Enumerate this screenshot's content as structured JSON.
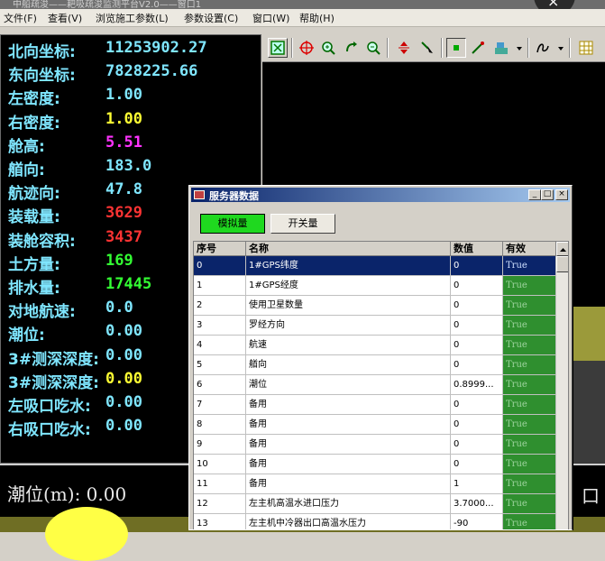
{
  "window": {
    "title": "中船疏浚——耙吸疏浚监测平台V2.0——窗口1"
  },
  "close_overlay": {
    "glyph": "×"
  },
  "menu": [
    {
      "label": "文件(F)"
    },
    {
      "label": "查看(V)"
    },
    {
      "label": "浏览施工参数(L)"
    },
    {
      "label": "参数设置(C)"
    },
    {
      "label": "窗口(W)"
    },
    {
      "label": "帮助(H)"
    }
  ],
  "left_panel": {
    "rows": [
      {
        "label": "北向坐标:",
        "value": "11253902.27",
        "color": "#7fe6ff"
      },
      {
        "label": "东向坐标:",
        "value": "7828225.66",
        "color": "#7fe6ff"
      },
      {
        "label": "左密度:",
        "value": "1.00",
        "color": "#7fe6ff"
      },
      {
        "label": "右密度:",
        "value": "1.00",
        "color": "#ffff33"
      },
      {
        "label": "舱高:",
        "value": "5.51",
        "color": "#ff33ff"
      },
      {
        "label": "艏向:",
        "value": "183.0",
        "color": "#7fe6ff"
      },
      {
        "label": "航迹向:",
        "value": "47.8",
        "color": "#7fe6ff"
      },
      {
        "label": "装载量:",
        "value": "3629",
        "color": "#ff3333"
      },
      {
        "label": "装舱容积:",
        "value": "3437",
        "color": "#ff3333"
      },
      {
        "label": "土方量:",
        "value": "169",
        "color": "#33ff33"
      },
      {
        "label": "排水量:",
        "value": "17445",
        "color": "#33ff33"
      },
      {
        "label": "对地航速:",
        "value": "0.0",
        "color": "#7fe6ff"
      },
      {
        "label": "潮位:",
        "value": "0.00",
        "color": "#7fe6ff"
      },
      {
        "label": "3#测深深度:",
        "value": "0.00",
        "color": "#7fe6ff"
      },
      {
        "label": "3#测深深度:",
        "value": "0.00",
        "color": "#ffff33"
      },
      {
        "label": "左吸口吃水:",
        "value": "0.00",
        "color": "#7fe6ff"
      },
      {
        "label": "右吸口吃水:",
        "value": "0.00",
        "color": "#7fe6ff"
      }
    ],
    "label_color": "#7fe6ff"
  },
  "bottom": {
    "tide_text": "潮位(m): 0.00",
    "right_char": "口"
  },
  "dialog": {
    "title": "服务器数据",
    "buttons": {
      "analog": "模拟量",
      "switch": "开关量"
    },
    "columns": [
      "序号",
      "名称",
      "数值",
      "有效"
    ],
    "rows": [
      [
        "0",
        "1#GPS纬度",
        "0",
        "True"
      ],
      [
        "1",
        "1#GPS经度",
        "0",
        "True"
      ],
      [
        "2",
        "使用卫星数量",
        "0",
        "True"
      ],
      [
        "3",
        "罗经方向",
        "0",
        "True"
      ],
      [
        "4",
        "航速",
        "0",
        "True"
      ],
      [
        "5",
        "艏向",
        "0",
        "True"
      ],
      [
        "6",
        "潮位",
        "0.8999...",
        "True"
      ],
      [
        "7",
        "备用",
        "0",
        "True"
      ],
      [
        "8",
        "备用",
        "0",
        "True"
      ],
      [
        "9",
        "备用",
        "0",
        "True"
      ],
      [
        "10",
        "备用",
        "0",
        "True"
      ],
      [
        "11",
        "备用",
        "1",
        "True"
      ],
      [
        "12",
        "左主机高温水进口压力",
        "3.7000...",
        "True"
      ],
      [
        "13",
        "左主机中冷器出口高温水压力",
        "-90",
        "True"
      ]
    ]
  }
}
